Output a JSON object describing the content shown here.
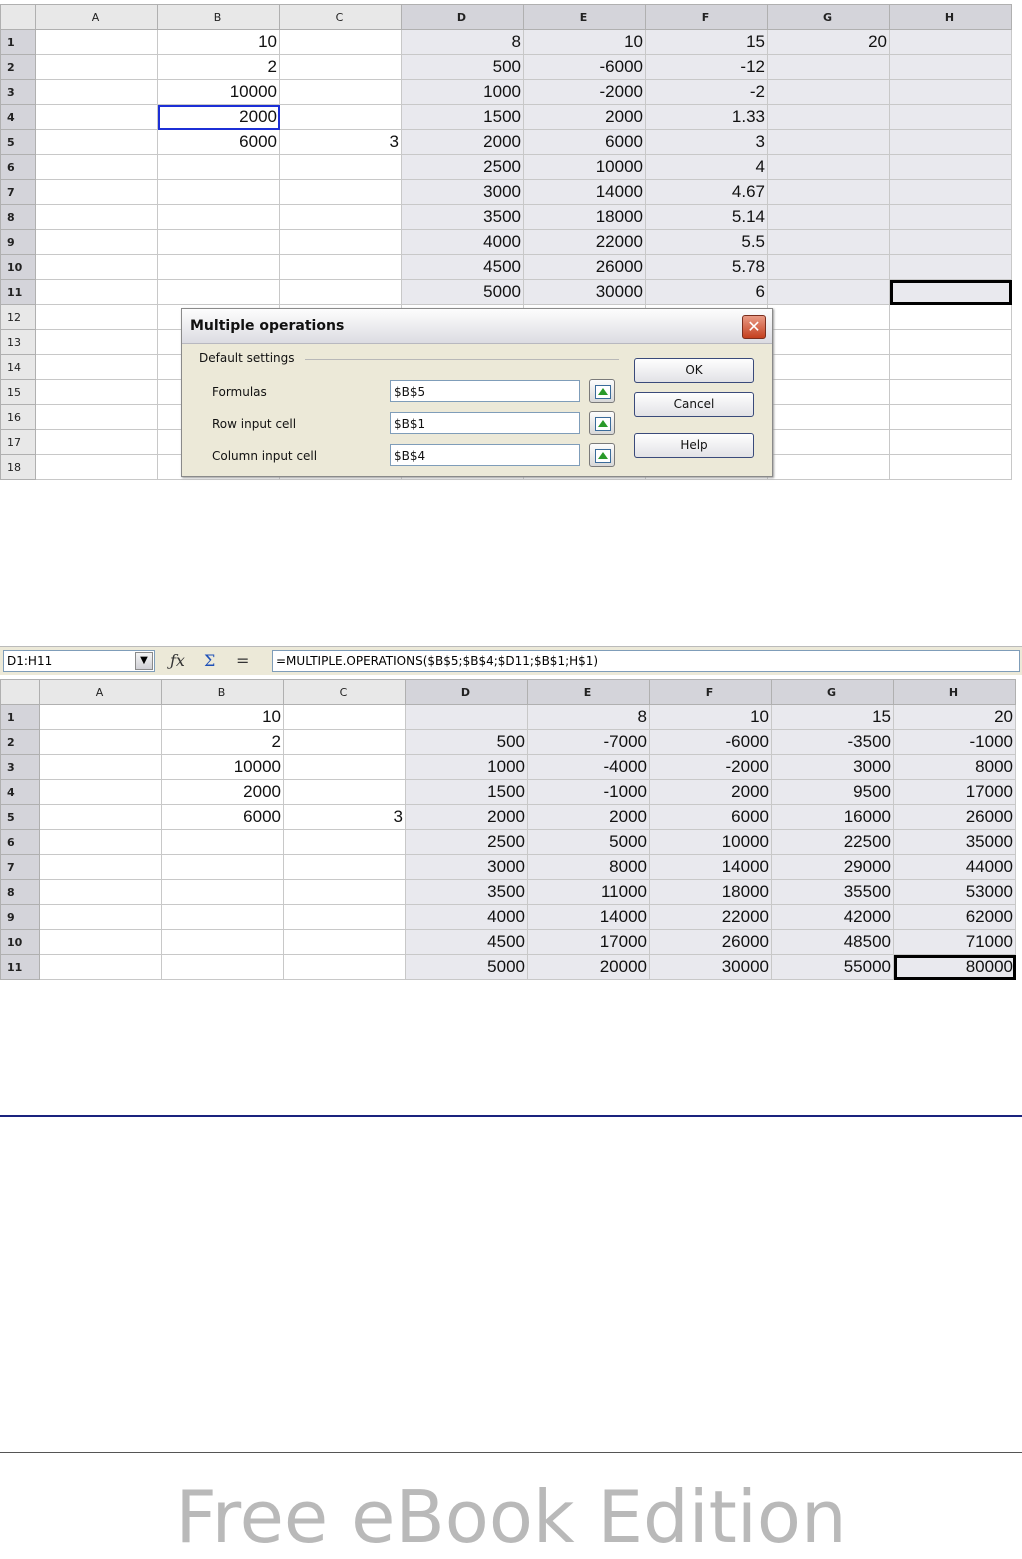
{
  "columns": [
    "A",
    "B",
    "C",
    "D",
    "E",
    "F",
    "G",
    "H"
  ],
  "sheet1": {
    "rows": [
      [
        "",
        "10",
        "",
        "8",
        "10",
        "15",
        "20",
        ""
      ],
      [
        "",
        "2",
        "",
        "500",
        "-6000",
        "-12",
        "",
        ""
      ],
      [
        "",
        "10000",
        "",
        "1000",
        "-2000",
        "-2",
        "",
        ""
      ],
      [
        "",
        "2000",
        "",
        "1500",
        "2000",
        "1.33",
        "",
        ""
      ],
      [
        "",
        "6000",
        "3",
        "2000",
        "6000",
        "3",
        "",
        ""
      ],
      [
        "",
        "",
        "",
        "2500",
        "10000",
        "4",
        "",
        ""
      ],
      [
        "",
        "",
        "",
        "3000",
        "14000",
        "4.67",
        "",
        ""
      ],
      [
        "",
        "",
        "",
        "3500",
        "18000",
        "5.14",
        "",
        ""
      ],
      [
        "",
        "",
        "",
        "4000",
        "22000",
        "5.5",
        "",
        ""
      ],
      [
        "",
        "",
        "",
        "4500",
        "26000",
        "5.78",
        "",
        ""
      ],
      [
        "",
        "",
        "",
        "5000",
        "30000",
        "6",
        "",
        ""
      ],
      [
        "",
        "",
        "",
        "",
        "",
        "",
        "",
        ""
      ],
      [
        "",
        "",
        "",
        "",
        "",
        "",
        "",
        ""
      ],
      [
        "",
        "",
        "",
        "",
        "",
        "",
        "",
        ""
      ],
      [
        "",
        "",
        "",
        "",
        "",
        "",
        "",
        ""
      ],
      [
        "",
        "",
        "",
        "",
        "",
        "",
        "",
        ""
      ],
      [
        "",
        "",
        "",
        "",
        "",
        "",
        "",
        ""
      ],
      [
        "",
        "",
        "",
        "",
        "",
        "",
        "",
        ""
      ]
    ]
  },
  "dialog": {
    "title": "Multiple operations",
    "close_label": "✕",
    "group_label": "Default settings",
    "fields": [
      {
        "label": "Formulas",
        "value": "$B$5"
      },
      {
        "label": "Row input cell",
        "value": "$B$1"
      },
      {
        "label": "Column input cell",
        "value": "$B$4"
      }
    ],
    "buttons": {
      "ok": "OK",
      "cancel": "Cancel",
      "help": "Help"
    }
  },
  "formula_bar": {
    "name_box": "D1:H11",
    "formula": "=MULTIPLE.OPERATIONS($B$5;$B$4;$D11;$B$1;H$1)",
    "icons": [
      "function-wizard-icon",
      "sum-icon",
      "equals-icon"
    ]
  },
  "sheet2": {
    "rows": [
      [
        "",
        "10",
        "",
        "",
        "8",
        "10",
        "15",
        "20"
      ],
      [
        "",
        "2",
        "",
        "500",
        "-7000",
        "-6000",
        "-3500",
        "-1000"
      ],
      [
        "",
        "10000",
        "",
        "1000",
        "-4000",
        "-2000",
        "3000",
        "8000"
      ],
      [
        "",
        "2000",
        "",
        "1500",
        "-1000",
        "2000",
        "9500",
        "17000"
      ],
      [
        "",
        "6000",
        "3",
        "2000",
        "2000",
        "6000",
        "16000",
        "26000"
      ],
      [
        "",
        "",
        "",
        "2500",
        "5000",
        "10000",
        "22500",
        "35000"
      ],
      [
        "",
        "",
        "",
        "3000",
        "8000",
        "14000",
        "29000",
        "44000"
      ],
      [
        "",
        "",
        "",
        "3500",
        "11000",
        "18000",
        "35500",
        "53000"
      ],
      [
        "",
        "",
        "",
        "4000",
        "14000",
        "22000",
        "42000",
        "62000"
      ],
      [
        "",
        "",
        "",
        "4500",
        "17000",
        "26000",
        "48500",
        "71000"
      ],
      [
        "",
        "",
        "",
        "5000",
        "20000",
        "30000",
        "55000",
        "80000"
      ]
    ]
  },
  "watermark": "Free eBook Edition",
  "colors": {
    "rule": "#1a237e",
    "selection_bg": "#e9e9ee",
    "cursor": "#1c2fd6"
  }
}
